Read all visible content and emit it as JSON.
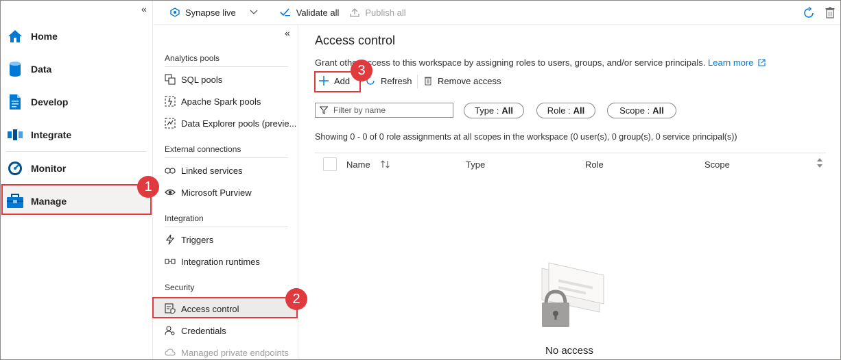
{
  "leftnav": {
    "items": [
      {
        "label": "Home",
        "icon": "home-icon"
      },
      {
        "label": "Data",
        "icon": "database-icon"
      },
      {
        "label": "Develop",
        "icon": "document-icon"
      },
      {
        "label": "Integrate",
        "icon": "pipeline-icon"
      },
      {
        "label": "Monitor",
        "icon": "gauge-icon"
      },
      {
        "label": "Manage",
        "icon": "toolbox-icon"
      }
    ]
  },
  "toolbar": {
    "live_label": "Synapse live",
    "validate_label": "Validate all",
    "publish_label": "Publish all"
  },
  "midpanel": {
    "sections": [
      {
        "header": "Analytics pools",
        "items": [
          "SQL pools",
          "Apache Spark pools",
          "Data Explorer pools (previe..."
        ]
      },
      {
        "header": "External connections",
        "items": [
          "Linked services",
          "Microsoft Purview"
        ]
      },
      {
        "header": "Integration",
        "items": [
          "Triggers",
          "Integration runtimes"
        ]
      },
      {
        "header": "Security",
        "items": [
          "Access control",
          "Credentials",
          "Managed private endpoints"
        ]
      }
    ]
  },
  "main": {
    "title": "Access control",
    "description": "Grant other access to this workspace by assigning roles to users, groups, and/or service principals.",
    "learn_more": "Learn more",
    "add_label": "Add",
    "refresh_label": "Refresh",
    "remove_label": "Remove access",
    "filter_placeholder": "Filter by name",
    "pills": [
      {
        "name": "Type :",
        "value": "All"
      },
      {
        "name": "Role :",
        "value": "All"
      },
      {
        "name": "Scope :",
        "value": "All"
      }
    ],
    "showing": "Showing 0 - 0 of 0 role assignments at all scopes in the workspace (0 user(s), 0 group(s), 0 service principal(s))",
    "columns": [
      "Name",
      "Type",
      "Role",
      "Scope"
    ],
    "empty_text": "No access"
  },
  "annotations": [
    "1",
    "2",
    "3"
  ],
  "colors": {
    "accent": "#0078d4",
    "annotation": "#e0393e"
  }
}
